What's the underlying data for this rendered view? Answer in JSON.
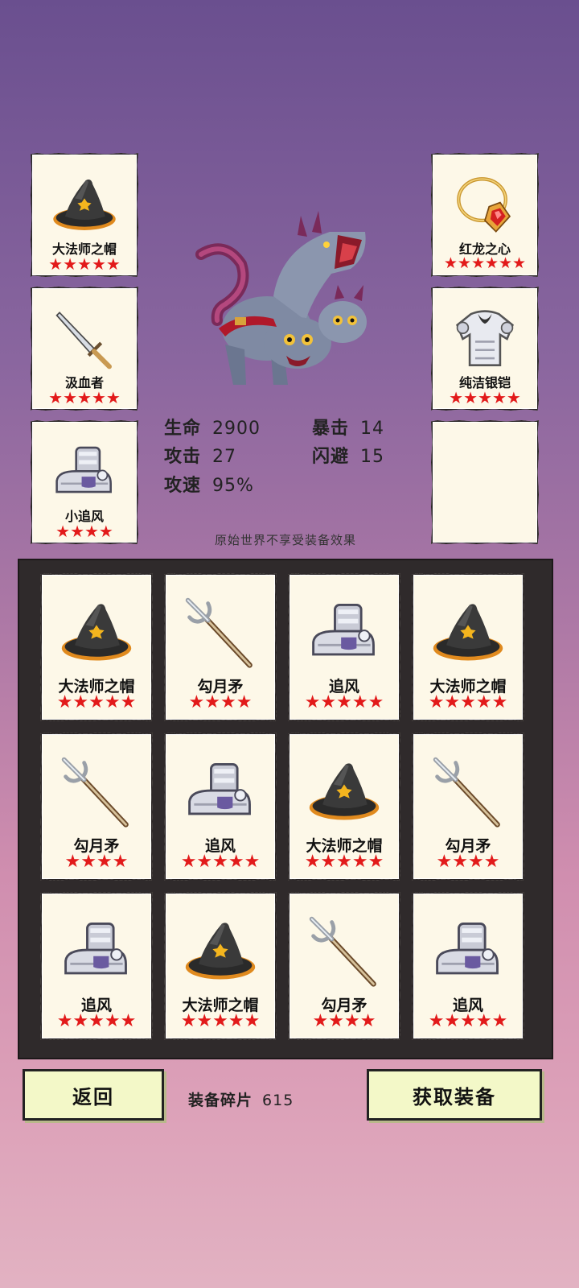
{
  "equipped": {
    "hat": {
      "name": "大法师之帽",
      "stars": "★★★★★",
      "icon": "wizard-hat-icon"
    },
    "weapon": {
      "name": "汲血者",
      "stars": "★★★★★",
      "icon": "dagger-icon"
    },
    "boots": {
      "name": "小追风",
      "stars": "★★★★",
      "icon": "boots-icon"
    },
    "amulet": {
      "name": "红龙之心",
      "stars": "★★★★★★",
      "icon": "amulet-icon"
    },
    "armor": {
      "name": "纯洁银铠",
      "stars": "★★★★★",
      "icon": "armor-icon"
    },
    "empty": {
      "name": "",
      "stars": ""
    }
  },
  "stats": {
    "hp_label": "生命",
    "hp": "2900",
    "atk_label": "攻击",
    "atk": "27",
    "spd_label": "攻速",
    "spd": "95%",
    "crit_label": "暴击",
    "crit": "14",
    "dodge_label": "闪避",
    "dodge": "15"
  },
  "notice": "原始世界不享受装备效果",
  "inventory": [
    {
      "name": "大法师之帽",
      "stars": "★★★★★",
      "icon": "wizard-hat-icon"
    },
    {
      "name": "勾月矛",
      "stars": "★★★★",
      "icon": "spear-icon"
    },
    {
      "name": "追风",
      "stars": "★★★★★",
      "icon": "boots-icon"
    },
    {
      "name": "大法师之帽",
      "stars": "★★★★★",
      "icon": "wizard-hat-icon"
    },
    {
      "name": "勾月矛",
      "stars": "★★★★",
      "icon": "spear-icon"
    },
    {
      "name": "追风",
      "stars": "★★★★★",
      "icon": "boots-icon"
    },
    {
      "name": "大法师之帽",
      "stars": "★★★★★",
      "icon": "wizard-hat-icon"
    },
    {
      "name": "勾月矛",
      "stars": "★★★★",
      "icon": "spear-icon"
    },
    {
      "name": "追风",
      "stars": "★★★★★",
      "icon": "boots-icon"
    },
    {
      "name": "大法师之帽",
      "stars": "★★★★★",
      "icon": "wizard-hat-icon"
    },
    {
      "name": "勾月矛",
      "stars": "★★★★",
      "icon": "spear-icon"
    },
    {
      "name": "追风",
      "stars": "★★★★★",
      "icon": "boots-icon"
    }
  ],
  "footer": {
    "back_label": "返回",
    "fragments_label": "装备碎片",
    "fragments_value": "615",
    "get_label": "获取装备"
  },
  "colors": {
    "star": "#e21a1a",
    "button": "#f3f8c8",
    "panel": "#2f2a2b"
  }
}
